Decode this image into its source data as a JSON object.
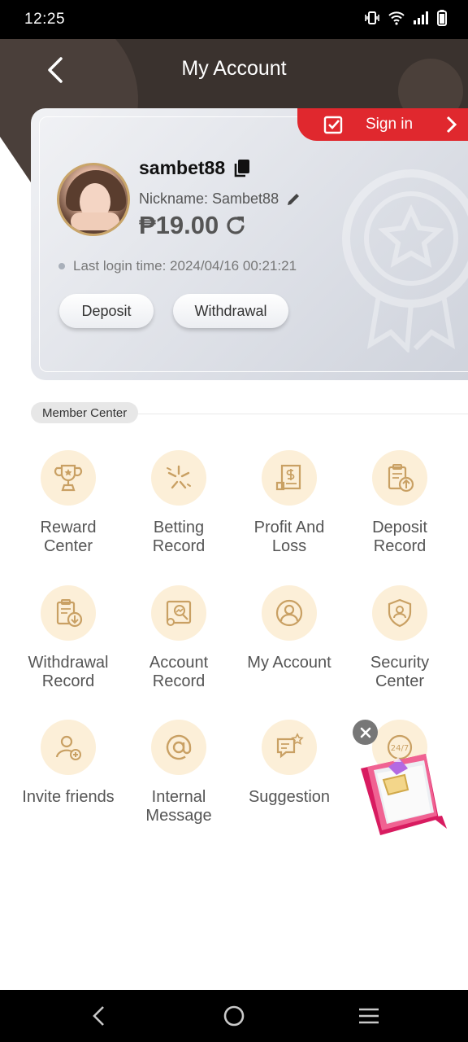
{
  "status_bar": {
    "time": "12:25",
    "icons": [
      "vibrate-icon",
      "wifi-icon",
      "signal-icon",
      "battery-icon"
    ]
  },
  "header": {
    "title": "My Account",
    "back_icon": "chevron-left-icon"
  },
  "signin": {
    "label": "Sign in",
    "icon": "calendar-check-icon"
  },
  "profile": {
    "username": "sambet88",
    "nickname": "Nickname: Sambet88",
    "balance": "₱19.00",
    "last_login": "Last login time: 2024/04/16 00:21:21",
    "deposit_label": "Deposit",
    "withdrawal_label": "Withdrawal"
  },
  "member_center": {
    "title": "Member Center",
    "items": [
      {
        "label": "Reward\nCenter",
        "icon": "trophy-icon"
      },
      {
        "label": "Betting\nRecord",
        "icon": "star-burst-icon"
      },
      {
        "label": "Profit And\nLoss",
        "icon": "invoice-dollar-icon"
      },
      {
        "label": "Deposit\nRecord",
        "icon": "clipboard-upload-icon"
      },
      {
        "label": "Withdrawal\nRecord",
        "icon": "clipboard-download-icon"
      },
      {
        "label": "Account\nRecord",
        "icon": "chart-report-icon"
      },
      {
        "label": "My Account",
        "icon": "user-circle-icon"
      },
      {
        "label": "Security\nCenter",
        "icon": "shield-user-icon"
      },
      {
        "label": "Invite friends",
        "icon": "user-add-icon"
      },
      {
        "label": "Internal\nMessage",
        "icon": "at-sign-icon"
      },
      {
        "label": "Suggestion",
        "icon": "chat-star-icon"
      },
      {
        "label": "",
        "icon": "support-247-icon"
      }
    ]
  },
  "colors": {
    "header_bg": "#3a322e",
    "signin_red": "#e0282e",
    "icon_bg": "#fcefd8",
    "icon_gold": "#c9a063"
  },
  "nav_bar": {
    "buttons": [
      "nav-back-icon",
      "nav-home-icon",
      "nav-menu-icon"
    ]
  }
}
